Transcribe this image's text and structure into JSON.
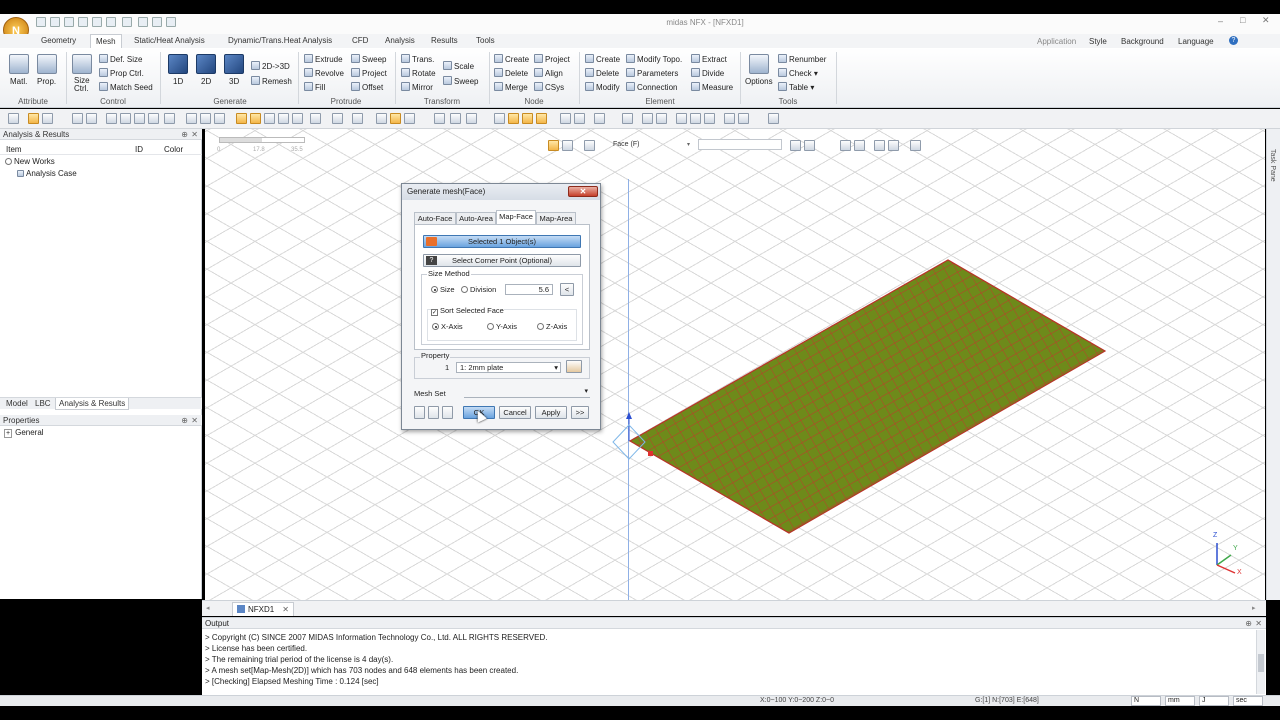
{
  "window": {
    "title": "midas NFX - [NFXD1]"
  },
  "app_button": {
    "glyph": "N"
  },
  "ribbon_tabs": [
    "Geometry",
    "Mesh",
    "Static/Heat Analysis",
    "Dynamic/Trans.Heat Analysis",
    "CFD",
    "Analysis",
    "Results",
    "Tools"
  ],
  "ribbon_active_tab": "Mesh",
  "ribbon_right": {
    "application": "Application",
    "style": "Style",
    "background": "Background",
    "language": "Language"
  },
  "ribbon_groups": {
    "attribute": {
      "label": "Attribute",
      "matl": "Matl.",
      "prop": "Prop."
    },
    "control": {
      "label": "Control",
      "size_ctrl": "Size Ctrl.",
      "def_size": "Def. Size",
      "prop_ctrl": "Prop Ctrl.",
      "match_seed": "Match Seed"
    },
    "generate": {
      "label": "Generate",
      "d1": "1D",
      "d2": "2D",
      "d3": "3D",
      "d2to3": "2D->3D",
      "remesh": "Remesh"
    },
    "protrude": {
      "label": "Protrude",
      "extrude": "Extrude",
      "revolve": "Revolve",
      "fill": "Fill",
      "sweep": "Sweep",
      "project": "Project",
      "offset": "Offset"
    },
    "transform": {
      "label": "Transform",
      "trans": "Trans.",
      "rotate": "Rotate",
      "mirror": "Mirror",
      "scale": "Scale",
      "sweep": "Sweep"
    },
    "node": {
      "label": "Node",
      "create": "Create",
      "delete": "Delete",
      "merge": "Merge",
      "project": "Project",
      "align": "Align",
      "csys": "CSys"
    },
    "element": {
      "label": "Element",
      "create": "Create",
      "delete": "Delete",
      "modify": "Modify",
      "modify_topo": "Modify Topo.",
      "parameters": "Parameters",
      "connection": "Connection",
      "extract": "Extract",
      "divide": "Divide",
      "measure": "Measure"
    },
    "tools": {
      "label": "Tools",
      "options": "Options",
      "renumber": "Renumber",
      "check": "Check",
      "table": "Table"
    }
  },
  "left_panel": {
    "title": "Analysis & Results",
    "columns": {
      "item": "Item",
      "id": "ID",
      "color": "Color"
    },
    "tree": [
      {
        "label": "New Works"
      },
      {
        "label": "Analysis Case"
      }
    ],
    "bottom_tabs": [
      "Model",
      "LBC",
      "Analysis & Results"
    ],
    "active_bottom_tab": "Analysis & Results"
  },
  "properties_panel": {
    "title": "Properties",
    "group": "General"
  },
  "viewport": {
    "view_label": "Face (F)",
    "ruler": [
      "0",
      "17.8",
      "35.5"
    ],
    "axis": {
      "x": "X",
      "y": "Y",
      "z": "Z"
    }
  },
  "task_pane": {
    "label": "Task Pane"
  },
  "dialog": {
    "title": "Generate mesh(Face)",
    "close_glyph": "✕",
    "tabs": [
      "Auto-Face",
      "Auto-Area",
      "Map-Face",
      "Map-Area"
    ],
    "active_tab": "Map-Face",
    "selected_objects": "Selected 1 Object(s)",
    "select_corner": "Select Corner Point (Optional)",
    "size_method": {
      "label": "Size Method",
      "size": "Size",
      "division": "Division",
      "value": "5.6",
      "selected": "Size"
    },
    "sort_face": {
      "label": "Sort Selected Face",
      "checked": true,
      "x": "X-Axis",
      "y": "Y-Axis",
      "z": "Z-Axis",
      "selected": "X-Axis"
    },
    "property": {
      "label": "Property",
      "id": "1",
      "value": "1: 2mm plate"
    },
    "mesh_set": {
      "label": "Mesh Set",
      "value": ""
    },
    "buttons": {
      "ok": "OK",
      "cancel": "Cancel",
      "apply": "Apply",
      "more": ">>"
    }
  },
  "doc_tab": {
    "label": "NFXD1"
  },
  "output": {
    "title": "Output",
    "lines": [
      "> Copyright (C) SINCE 2007 MIDAS Information Technology Co., Ltd. ALL RIGHTS RESERVED.",
      "> License has been certified.",
      "> The remaining trial period of the license is 4 day(s).",
      "> A mesh set[Map-Mesh(2D)] which has 703 nodes and 648 elements has been created.",
      "> [Checking] Elapsed Meshing Time : 0.124 [sec]"
    ]
  },
  "status": {
    "coords": "X:0~100 Y:0~200 Z:0~0",
    "counts": "G:[1] N:[703] E:[648]",
    "units": [
      "N",
      "mm",
      "J",
      "sec"
    ]
  },
  "colors": {
    "mesh_fill": "#6e8a1a",
    "mesh_line": "#c0392b",
    "accent": "#3f77b3"
  }
}
